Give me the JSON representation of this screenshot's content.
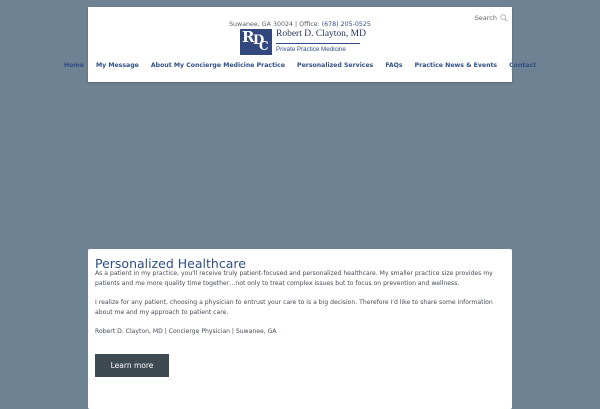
{
  "header": {
    "address": "Suwanee, GA 30024",
    "office_label": "| Office:",
    "phone": "(678) 205-0525",
    "search_label": "Search",
    "search_icon": "search-icon",
    "logo": {
      "monogram": "RDC",
      "name": "Robert D. Clayton, MD",
      "tagline": "Private Practice Medicine"
    }
  },
  "nav": {
    "items": [
      "Home",
      "My Message",
      "About My Concierge Medicine Practice",
      "Personalized Services",
      "FAQs",
      "Practice News & Events",
      "Contact"
    ]
  },
  "main": {
    "title": "Personalized Healthcare",
    "paragraphs": [
      "As a patient in my practice, you'll receive truly patient-focused and personalized healthcare. My smaller practice size provides my patients and me more quality time together…not only to treat complex issues but to focus on prevention and wellness.",
      "I realize for any patient, choosing a physician to entrust your care to is a big decision. Therefore I'd like to share some information about me and my approach to patient care.",
      "Robert D. Clayton, MD | Concierge Physician | Suwanee, GA"
    ],
    "button_label": "Learn more"
  },
  "colors": {
    "background": "#6f8293",
    "accent": "#2f4f86",
    "button": "#3d4a52"
  }
}
